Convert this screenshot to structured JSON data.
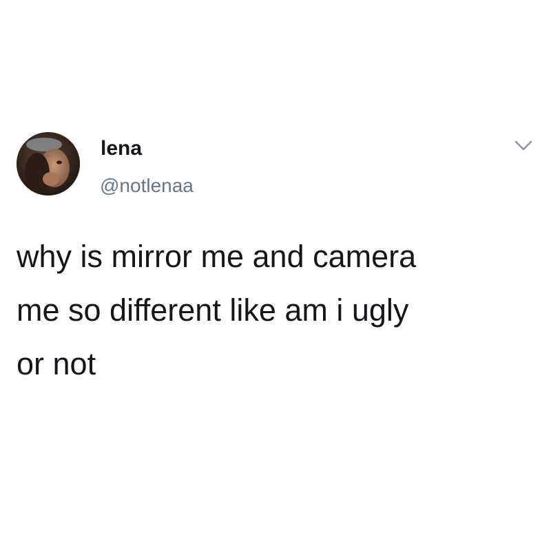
{
  "author": {
    "display_name": "lena",
    "handle": "@notlenaa"
  },
  "tweet": {
    "lines": [
      "why is mirror me and camera",
      "me so different like am i ugly",
      "or not"
    ]
  },
  "icons": {
    "avatar": "profile-photo",
    "menu": "chevron-down-icon"
  },
  "colors": {
    "text": "#14171a",
    "secondary": "#657786",
    "caret": "#8899a6"
  }
}
